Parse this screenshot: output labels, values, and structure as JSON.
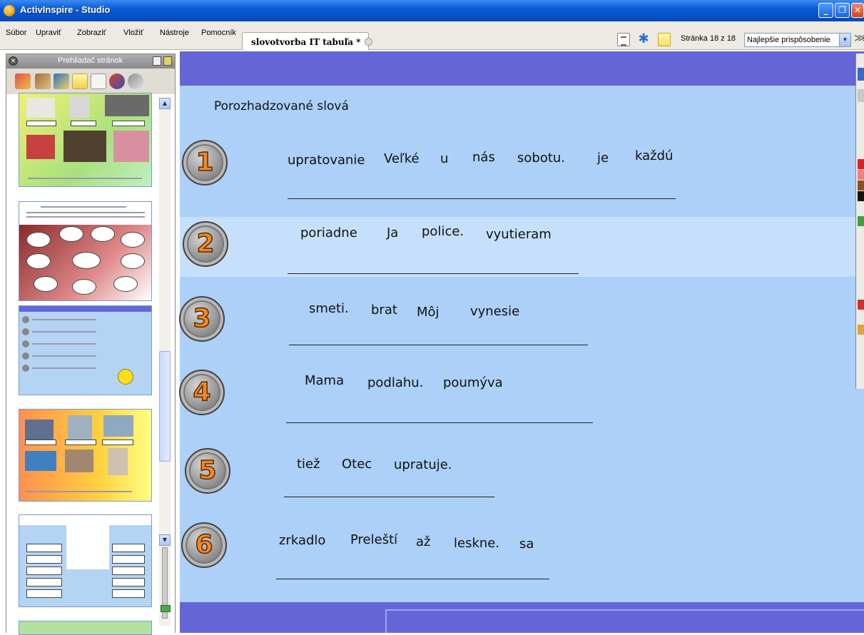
{
  "window": {
    "title": "ActivInspire - Studio"
  },
  "menu": {
    "items": [
      "Súbor",
      "Upraviť",
      "Zobraziť",
      "Vložiť",
      "Nástroje",
      "Pomocník"
    ]
  },
  "document_tab": {
    "label": "slovotvorba IT tabuľa *"
  },
  "toolbar": {
    "page_counter": "Stránka 18 z 18",
    "zoom": "Najlepšie prispôsobenie"
  },
  "page_browser": {
    "title": "Prehliadač stránok",
    "thumbnails": [
      "thumb-1",
      "thumb-2",
      "thumb-3",
      "thumb-4",
      "thumb-5",
      "thumb-6"
    ]
  },
  "flipchart": {
    "heading": "Porozhadzované slová",
    "rows": [
      {
        "number": "1",
        "words": [
          "upratovanie",
          "Veľké",
          "u",
          "nás",
          "sobotu.",
          "je",
          "každú"
        ]
      },
      {
        "number": "2",
        "words": [
          "poriadne",
          "Ja",
          "police.",
          "vyutieram"
        ]
      },
      {
        "number": "3",
        "words": [
          "smeti.",
          "brat",
          "Môj",
          "vynesie"
        ]
      },
      {
        "number": "4",
        "words": [
          "Mama",
          "podlahu.",
          "poumýva"
        ]
      },
      {
        "number": "5",
        "words": [
          "tiež",
          "Otec",
          "upratuje."
        ]
      },
      {
        "number": "6",
        "words": [
          "zrkadlo",
          "Preleští",
          "až",
          "leskne.",
          "sa"
        ]
      }
    ]
  }
}
